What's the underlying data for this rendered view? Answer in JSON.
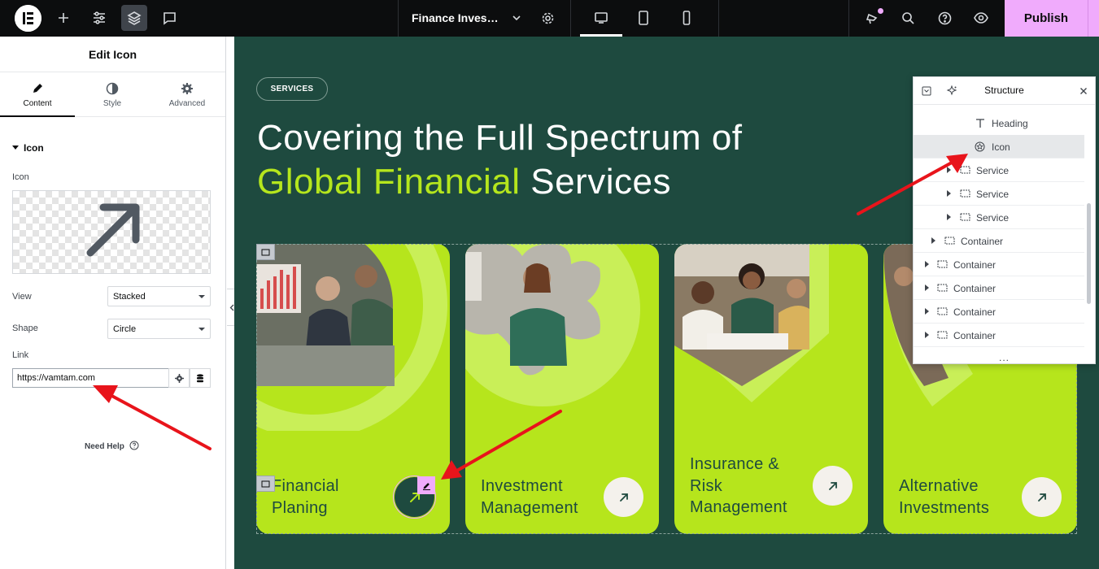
{
  "topbar": {
    "document_title": "Finance Investm…",
    "publish_label": "Publish"
  },
  "panel": {
    "title": "Edit Icon",
    "tabs": [
      {
        "label": "Content",
        "icon": "pencil-icon",
        "active": true
      },
      {
        "label": "Style",
        "icon": "contrast-icon",
        "active": false
      },
      {
        "label": "Advanced",
        "icon": "gear-icon",
        "active": false
      }
    ],
    "section_title": "Icon",
    "icon_label": "Icon",
    "view_label": "View",
    "view_value": "Stacked",
    "shape_label": "Shape",
    "shape_value": "Circle",
    "link_label": "Link",
    "link_value": "https://vamtam.com",
    "need_help": "Need Help"
  },
  "canvas": {
    "pill": "SERVICES",
    "headline_line1": "Covering the Full Spectrum of",
    "headline_highlight": "Global Financial",
    "headline_rest": " Services",
    "cards": [
      {
        "title_l1": "Financial",
        "title_l2": "Planing",
        "title_l3": ""
      },
      {
        "title_l1": "Investment",
        "title_l2": "Management",
        "title_l3": ""
      },
      {
        "title_l1": "Insurance &",
        "title_l2": "Risk",
        "title_l3": "Management"
      },
      {
        "title_l1": "Alternative",
        "title_l2": "Investments",
        "title_l3": ""
      }
    ]
  },
  "structure": {
    "title": "Structure",
    "rows": [
      {
        "label": "Heading",
        "icon": "text-icon"
      },
      {
        "label": "Icon",
        "icon": "star-circle-icon",
        "selected": true
      },
      {
        "label": "Service",
        "icon": "container-icon"
      },
      {
        "label": "Service",
        "icon": "container-icon"
      },
      {
        "label": "Service",
        "icon": "container-icon"
      },
      {
        "label": "Container",
        "icon": "container-icon"
      },
      {
        "label": "Container",
        "icon": "container-icon"
      },
      {
        "label": "Container",
        "icon": "container-icon"
      },
      {
        "label": "Container",
        "icon": "container-icon"
      },
      {
        "label": "Container",
        "icon": "container-icon"
      }
    ],
    "more": "..."
  },
  "colors": {
    "canvas_bg": "#1e4a3f",
    "lime": "#b6e51c",
    "publish": "#f0abfc",
    "annotation": "#e8141b"
  }
}
